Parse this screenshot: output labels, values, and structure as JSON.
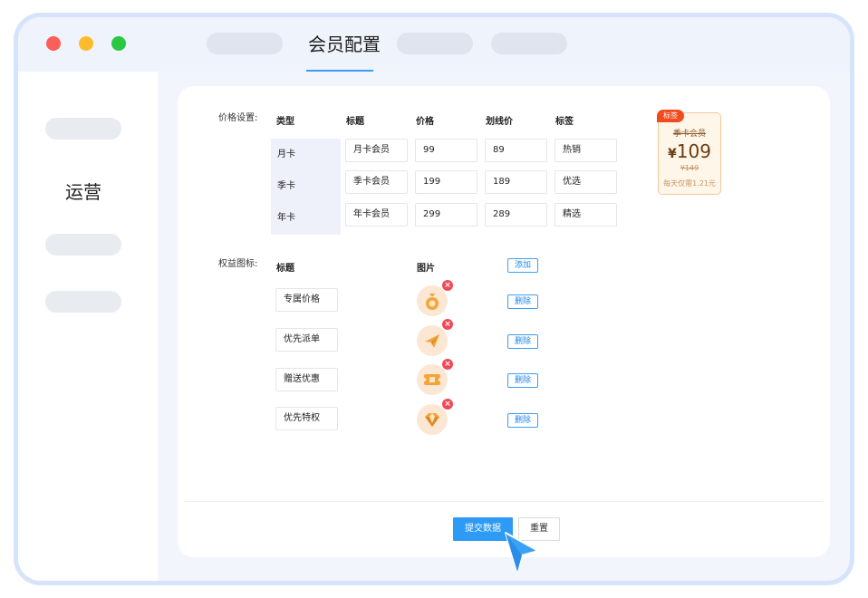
{
  "window": {
    "title": "会员配置",
    "colors": {
      "close": "#fc5f57",
      "minimize": "#fdbc2e",
      "maximize": "#29c840",
      "accent": "#2d9af5"
    }
  },
  "sidebar": {
    "active_label": "运营"
  },
  "pricing": {
    "section_label": "价格设置:",
    "headers": [
      "类型",
      "标题",
      "价格",
      "划线价",
      "标签"
    ],
    "rows": [
      {
        "type": "月卡",
        "title": "月卡会员",
        "price": "99",
        "strike_price": "89",
        "tag": "热销"
      },
      {
        "type": "季卡",
        "title": "季卡会员",
        "price": "199",
        "strike_price": "189",
        "tag": "优选"
      },
      {
        "type": "年卡",
        "title": "年卡会员",
        "price": "299",
        "strike_price": "289",
        "tag": "精选"
      }
    ]
  },
  "preview_card": {
    "tag": "标签",
    "name": "季卡会员",
    "currency": "¥",
    "price": "109",
    "old_price": "¥149",
    "daily": "每天仅需1.21元"
  },
  "benefits": {
    "section_label": "权益图标:",
    "headers": {
      "title": "标题",
      "image": "图片"
    },
    "add_label": "添加",
    "delete_label": "删除",
    "remove_glyph": "×",
    "items": [
      {
        "title": "专属价格",
        "icon": "money-bag-icon"
      },
      {
        "title": "优先派单",
        "icon": "paper-plane-icon"
      },
      {
        "title": "赠送优惠",
        "icon": "coupon-icon"
      },
      {
        "title": "优先特权",
        "icon": "diamond-icon"
      }
    ]
  },
  "actions": {
    "submit_label": "提交数据",
    "reset_label": "重置"
  }
}
